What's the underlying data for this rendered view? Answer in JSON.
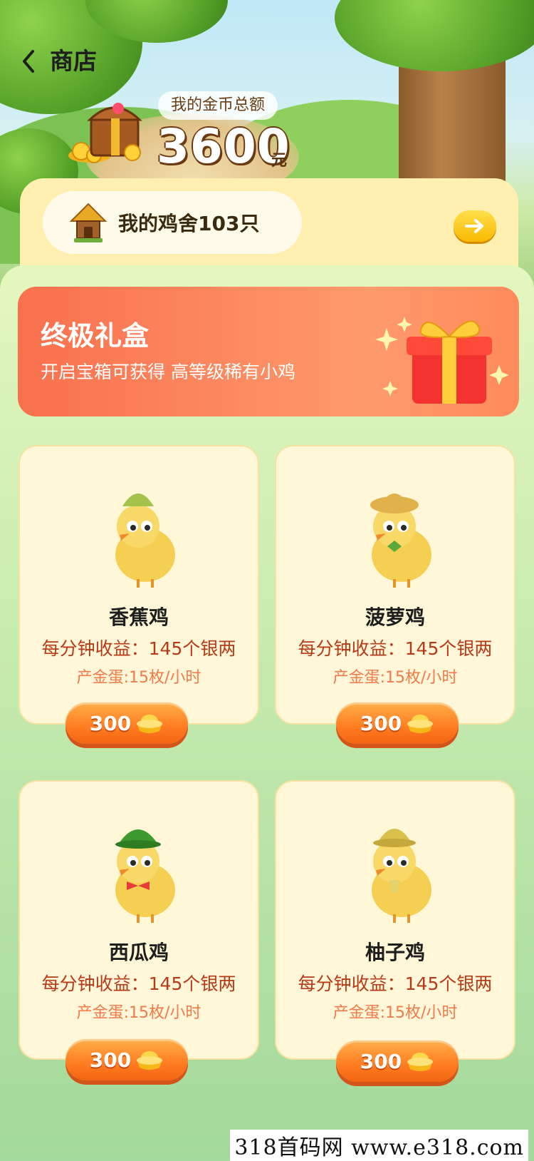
{
  "header": {
    "title": "商店"
  },
  "coins": {
    "label": "我的金币总额",
    "amount": "3600",
    "unit": "元"
  },
  "coop": {
    "text": "我的鸡舍103只"
  },
  "banner": {
    "title": "终极礼盒",
    "subtitle": "开启宝箱可获得 高等级稀有小鸡"
  },
  "products": [
    {
      "name": "香蕉鸡",
      "income": "每分钟收益：145个银两",
      "eggs": "产金蛋:15枚/小时",
      "price": "300",
      "hat_color": "#a3c34a"
    },
    {
      "name": "菠萝鸡",
      "income": "每分钟收益：145个银两",
      "eggs": "产金蛋:15枚/小时",
      "price": "300",
      "hat_color": "#e2b24a"
    },
    {
      "name": "西瓜鸡",
      "income": "每分钟收益：145个银两",
      "eggs": "产金蛋:15枚/小时",
      "price": "300",
      "hat_color": "#3e9a2e"
    },
    {
      "name": "柚子鸡",
      "income": "每分钟收益：145个银两",
      "eggs": "产金蛋:15枚/小时",
      "price": "300",
      "hat_color": "#d8c04a"
    }
  ],
  "icons": {
    "back": "chevron-left-icon",
    "arrow": "arrow-right-icon",
    "chest": "treasure-chest-icon",
    "coop": "chicken-coop-icon",
    "gift": "gift-box-icon",
    "ingot": "gold-ingot-icon"
  },
  "colors": {
    "accent": "#ff7c21",
    "banner": "#f9704d",
    "card": "#fff7d8",
    "income": "#b53a18"
  },
  "watermark": "318首码网  www.e318.com"
}
